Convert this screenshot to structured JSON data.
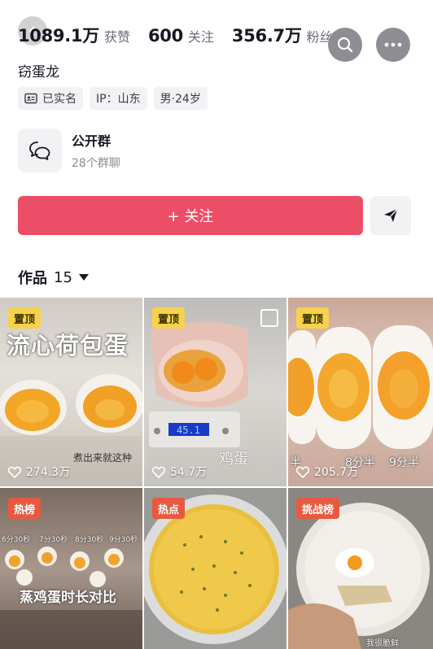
{
  "stats": [
    {
      "value": "1089.1万",
      "label": "获赞"
    },
    {
      "value": "600",
      "label": "关注"
    },
    {
      "value": "356.7万",
      "label": "粉丝"
    }
  ],
  "icons": {
    "back": "chevron-left-icon",
    "search": "search-icon",
    "more": "more-icon",
    "verified": "id-card-icon",
    "group": "chat-bubbles-icon",
    "share": "send-icon",
    "like": "heart-icon"
  },
  "profile": {
    "nickname": "窃蛋龙",
    "tags": {
      "verified": "已实名",
      "ip": "IP：山东",
      "gender_age": "男·24岁"
    }
  },
  "group": {
    "title": "公开群",
    "subtitle": "28个群聊"
  },
  "actions": {
    "follow": "+ 关注"
  },
  "works": {
    "label": "作品",
    "count": "15"
  },
  "videos": [
    {
      "badge": "置顶",
      "badge_type": "pin",
      "overlay": "流心荷包蛋",
      "caption": "煮出来就这种",
      "likes": "274.3万"
    },
    {
      "badge": "置顶",
      "badge_type": "pin",
      "caption": "鸡蛋",
      "likes": "54.7万"
    },
    {
      "badge": "置顶",
      "badge_type": "pin",
      "captions": [
        "半",
        "8分半",
        "9分半"
      ],
      "likes": "205.7万"
    },
    {
      "badge": "热榜",
      "badge_type": "hot",
      "overlay": "蒸鸡蛋时长对比",
      "captions": [
        "6分30秒",
        "7分30秒",
        "8分30秒",
        "9分30秒"
      ]
    },
    {
      "badge": "热点",
      "badge_type": "hot"
    },
    {
      "badge": "挑战榜",
      "badge_type": "hot",
      "caption": "我很脆鲜"
    }
  ],
  "colors": {
    "accent": "#ec4d67",
    "pin_badge": "#f6d24d",
    "hot_badge": "#e8593f"
  }
}
